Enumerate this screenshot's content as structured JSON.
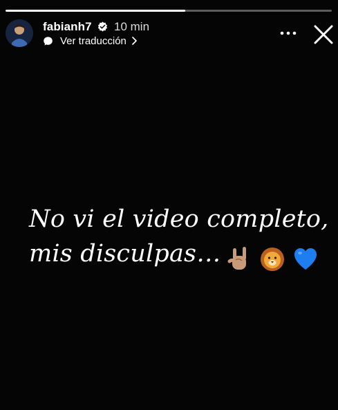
{
  "header": {
    "username": "fabianh7",
    "timestamp": "10 min",
    "translate_label": "Ver traducción",
    "progress": 0.55,
    "icons": {
      "avatar": "avatar",
      "verified": "verified-badge-icon",
      "translate": "translate-bubble-icon",
      "chevron": "chevron-right-icon",
      "more": "more-horizontal-icon",
      "close": "close-icon"
    }
  },
  "story": {
    "caption_line1": "No vi el video completo,",
    "caption_line2": "mis disculpas…",
    "emojis": [
      "sign-of-horns-emoji",
      "lion-face-emoji",
      "blue-heart-emoji"
    ]
  },
  "colors": {
    "background": "#050505",
    "text": "#ffffff",
    "heart": "#1e7ef0",
    "lion": "#f2a93b"
  }
}
